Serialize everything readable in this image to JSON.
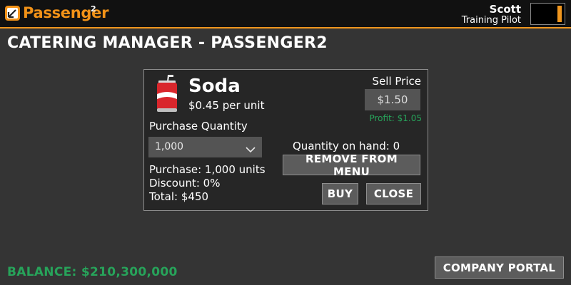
{
  "header": {
    "logo_text": "Passenger",
    "logo_superscript": "2",
    "user_name": "Scott",
    "user_rank": "Training Pilot"
  },
  "page": {
    "title": "CATERING MANAGER - PASSENGER2"
  },
  "item": {
    "icon": "soda-can-icon",
    "name": "Soda",
    "unit_price": "$0.45 per unit",
    "sell_price_label": "Sell Price",
    "sell_price_value": "$1.50",
    "profit_text": "Profit: $1.05",
    "purchase_quantity_label": "Purchase Quantity",
    "purchase_quantity_selected": "1,000",
    "purchase_text": "Purchase: 1,000 units",
    "discount_text": "Discount: 0%",
    "total_text": "Total: $450",
    "quantity_on_hand_text": "Quantity on hand: 0",
    "remove_button": "REMOVE FROM MENU",
    "buy_button": "BUY",
    "close_button": "CLOSE"
  },
  "footer": {
    "balance_text": "BALANCE: $210,300,000",
    "company_portal_button": "COMPANY PORTAL"
  },
  "colors": {
    "accent": "#f0961e",
    "profit_green": "#27a35a",
    "background": "#343434",
    "panel": "#262626",
    "button": "#5c5c5c"
  }
}
